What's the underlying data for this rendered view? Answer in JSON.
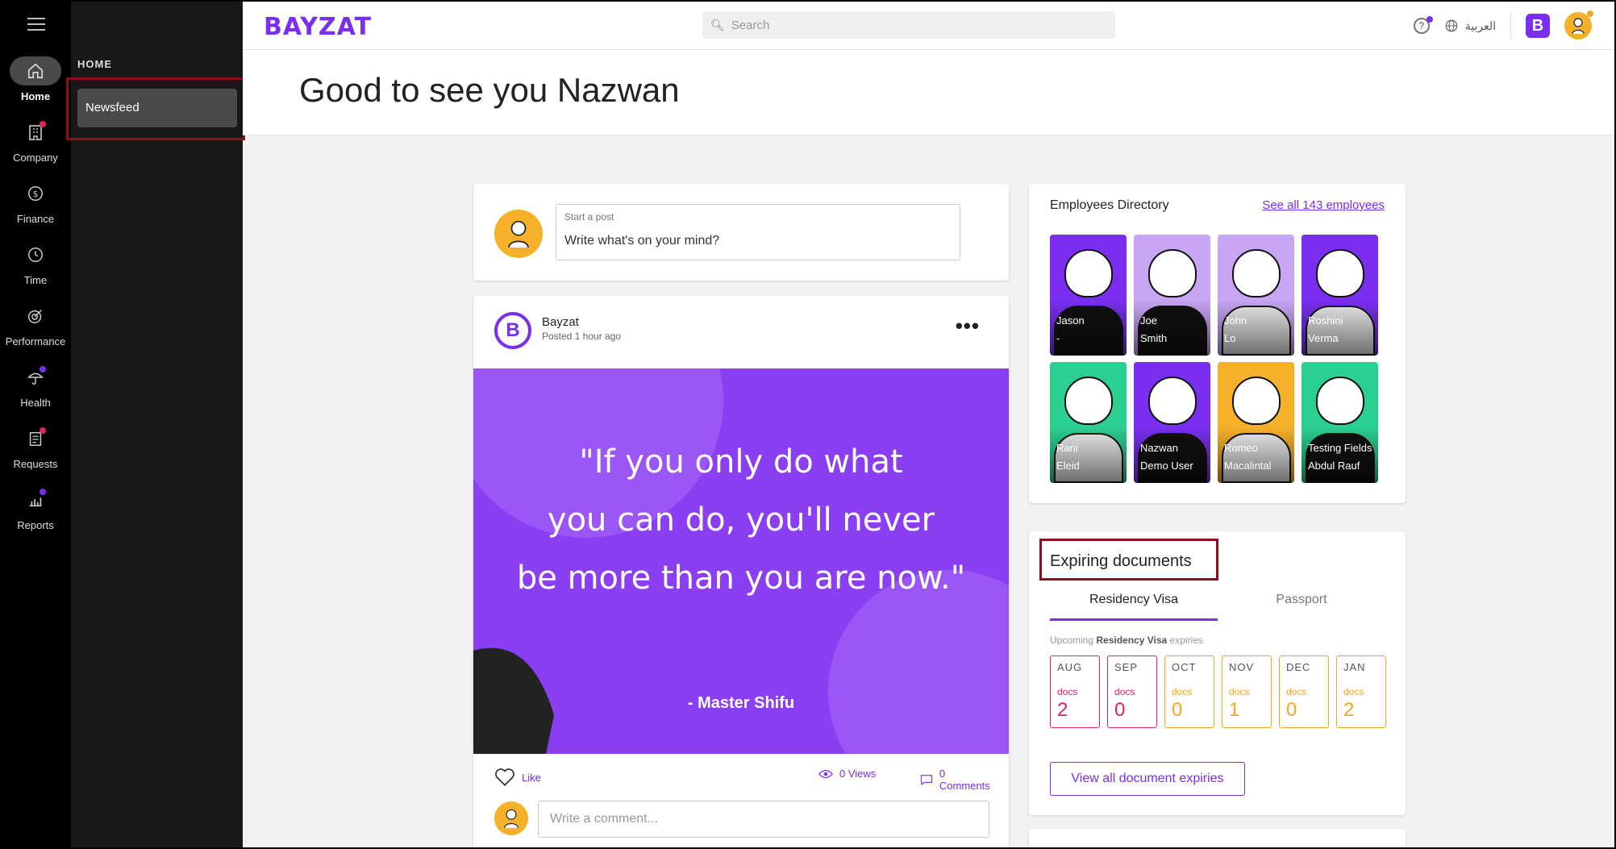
{
  "rail": {
    "items": [
      {
        "label": "Home",
        "icon": "home-icon"
      },
      {
        "label": "Company",
        "icon": "building-icon",
        "dot": "#e0245e"
      },
      {
        "label": "Finance",
        "icon": "dollar-icon"
      },
      {
        "label": "Time",
        "icon": "clock-icon"
      },
      {
        "label": "Performance",
        "icon": "target-icon"
      },
      {
        "label": "Health",
        "icon": "umbrella-icon",
        "dot": "#7a2ff0"
      },
      {
        "label": "Requests",
        "icon": "clipboard-icon",
        "dot": "#e0245e"
      },
      {
        "label": "Reports",
        "icon": "chart-icon",
        "dot": "#7a2ff0"
      }
    ]
  },
  "subnav": {
    "heading": "HOME",
    "item": "Newsfeed"
  },
  "header": {
    "logo": "BAYZAT",
    "search_placeholder": "Search",
    "language": "العربية",
    "company_badge": "B"
  },
  "greeting": "Good to see you Nazwan",
  "composer": {
    "label": "Start a post",
    "placeholder": "Write what's on your mind?"
  },
  "post": {
    "author": "Bayzat",
    "time": "Posted 1 hour ago",
    "quote_lines": [
      "\"If you only do what",
      "you can do, you'll never",
      "be more than you are now.\""
    ],
    "attribution": "- Master Shifu",
    "like": "Like",
    "views": "0 Views",
    "comments": "0 Comments",
    "comment_placeholder": "Write a comment..."
  },
  "directory": {
    "title": "Employees Directory",
    "see_all": "See all 143 employees",
    "employees": [
      {
        "line1": "Jason",
        "line2": "-",
        "bg": "#7a2ff0"
      },
      {
        "line1": "Joe",
        "line2": "Smith",
        "bg": "#c9a6f5"
      },
      {
        "line1": "John",
        "line2": "Lo",
        "bg": "#c9a6f5"
      },
      {
        "line1": "Roshini",
        "line2": "Verma",
        "bg": "#7a2ff0"
      },
      {
        "line1": "Rani",
        "line2": "Eleid",
        "bg": "#2bcf8f"
      },
      {
        "line1": "Nazwan",
        "line2": "Demo User",
        "bg": "#7a2ff0"
      },
      {
        "line1": "Romeo",
        "line2": "Macalintal",
        "bg": "#f5b12a"
      },
      {
        "line1": "Testing Fields",
        "line2": "Abdul Rauf",
        "bg": "#2bcf8f"
      }
    ]
  },
  "expiring": {
    "title": "Expiring documents",
    "tabs": [
      "Residency Visa",
      "Passport"
    ],
    "sub_prefix": "Upcoming ",
    "sub_bold": "Residency Visa",
    "sub_suffix": " expiries",
    "months": [
      {
        "m": "AUG",
        "d": "docs",
        "n": "2",
        "color": "#e0245e"
      },
      {
        "m": "SEP",
        "d": "docs",
        "n": "0",
        "color": "#e0245e"
      },
      {
        "m": "OCT",
        "d": "docs",
        "n": "0",
        "color": "#f5a623"
      },
      {
        "m": "NOV",
        "d": "docs",
        "n": "1",
        "color": "#f5a623"
      },
      {
        "m": "DEC",
        "d": "docs",
        "n": "0",
        "color": "#f5a623"
      },
      {
        "m": "JAN",
        "d": "docs",
        "n": "2",
        "color": "#f5a623"
      }
    ],
    "button": "View all document expiries"
  }
}
